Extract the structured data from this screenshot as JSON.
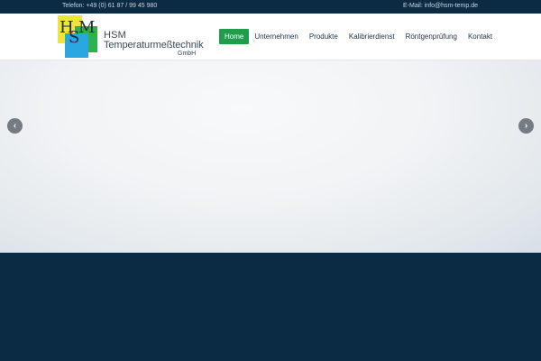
{
  "topbar": {
    "phone": "Telefon: +49 (0) 61 87 / 99 45 980",
    "email": "E-Mail: info@hsm-temp.de"
  },
  "logo": {
    "monogram": [
      "H",
      "S",
      "M"
    ],
    "line1": "HSM",
    "line2": "Temperaturmeßtechnik",
    "line3": "GmbH",
    "colors": {
      "yellow": "#ece63a",
      "green": "#2bb24c",
      "blue": "#2aa6e0"
    }
  },
  "nav": {
    "items": [
      {
        "label": "Home",
        "active": true
      },
      {
        "label": "Unternehmen",
        "active": false
      },
      {
        "label": "Produkte",
        "active": false
      },
      {
        "label": "Kalibrierdienst",
        "active": false
      },
      {
        "label": "Röntgenprüfung",
        "active": false
      },
      {
        "label": "Kontakt",
        "active": false
      }
    ],
    "active_color": "#1f9d4a"
  },
  "slider": {
    "prev_icon": "chevron-left-icon",
    "next_icon": "chevron-right-icon",
    "prev_glyph": "‹",
    "next_glyph": "›"
  },
  "theme": {
    "dark": "#0b2a44"
  }
}
